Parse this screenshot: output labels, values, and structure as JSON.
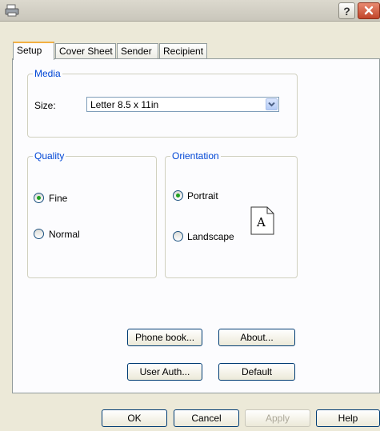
{
  "window": {
    "help_button": "?",
    "close_button": "X"
  },
  "tabs": [
    {
      "label": "Setup",
      "active": true
    },
    {
      "label": "Cover Sheet",
      "active": false
    },
    {
      "label": "Sender",
      "active": false
    },
    {
      "label": "Recipient",
      "active": false
    }
  ],
  "media": {
    "title": "Media",
    "size_label": "Size:",
    "size_value": "Letter 8.5 x 11in"
  },
  "quality": {
    "title": "Quality",
    "options": [
      {
        "label": "Fine",
        "checked": true
      },
      {
        "label": "Normal",
        "checked": false
      }
    ]
  },
  "orientation": {
    "title": "Orientation",
    "options": [
      {
        "label": "Portrait",
        "checked": true
      },
      {
        "label": "Landscape",
        "checked": false
      }
    ],
    "preview_letter": "A"
  },
  "panel_buttons": {
    "phone_book": "Phone book...",
    "about": "About...",
    "user_auth": "User Auth...",
    "default": "Default"
  },
  "dialog_buttons": {
    "ok": "OK",
    "cancel": "Cancel",
    "apply": "Apply",
    "help": "Help"
  },
  "colors": {
    "group_title": "#0046d5",
    "dialog_bg": "#ece9d8",
    "radio_dot": "#21a121"
  }
}
